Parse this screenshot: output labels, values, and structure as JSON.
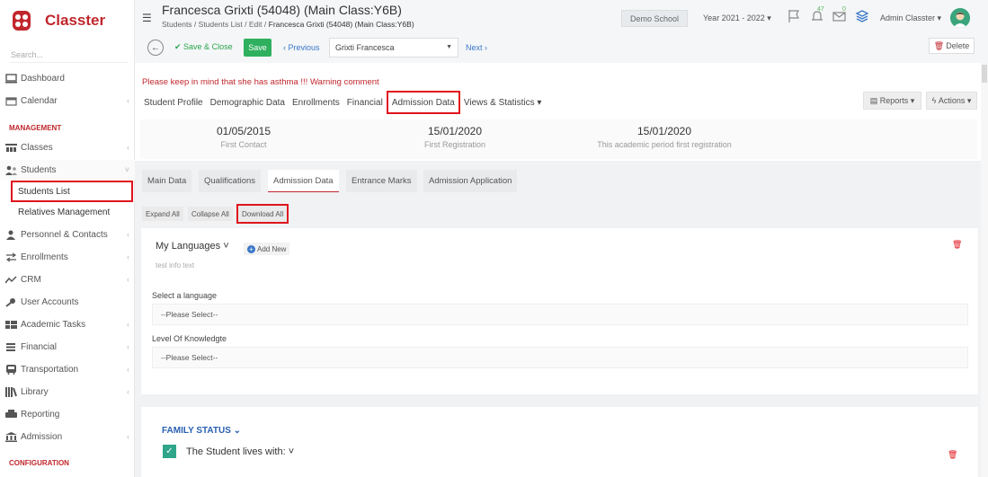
{
  "brand": {
    "name": "Classter",
    "color": "#c0272d"
  },
  "sidebar": {
    "search_placeholder": "Search...",
    "items_top": [
      {
        "label": "Dashboard",
        "icon": "monitor-icon"
      },
      {
        "label": "Calendar",
        "icon": "calendar-icon"
      }
    ],
    "section_management": "MANAGEMENT",
    "items_mgmt": [
      {
        "label": "Classes",
        "icon": "classes-icon"
      },
      {
        "label": "Students",
        "icon": "students-icon"
      }
    ],
    "students_sub": [
      "Students List",
      "Relatives Management"
    ],
    "items_rest": [
      {
        "label": "Personnel & Contacts",
        "icon": "personnel-icon"
      },
      {
        "label": "Enrollments",
        "icon": "enrollments-icon"
      },
      {
        "label": "CRM",
        "icon": "crm-icon"
      },
      {
        "label": "User Accounts",
        "icon": "key-icon"
      },
      {
        "label": "Academic Tasks",
        "icon": "tasks-icon"
      },
      {
        "label": "Financial",
        "icon": "financial-icon"
      },
      {
        "label": "Transportation",
        "icon": "bus-icon"
      },
      {
        "label": "Library",
        "icon": "library-icon"
      },
      {
        "label": "Reporting",
        "icon": "reporting-icon"
      },
      {
        "label": "Admission",
        "icon": "admission-icon"
      }
    ],
    "section_config": "CONFIGURATION"
  },
  "header": {
    "title": "Francesca Grixti (54048) (Main Class:Y6B)",
    "breadcrumbs": [
      "Students",
      "Students List",
      "Edit",
      "Francesca Grixti (54048) (Main Class:Y6B)"
    ],
    "school": "Demo School",
    "year": "Year 2021 - 2022",
    "notif_count": "47",
    "mail_count": "0",
    "user": "Admin Classter"
  },
  "toolbar": {
    "save_close": "Save & Close",
    "save": "Save",
    "previous": "Previous",
    "student_select": "Grixti Francesca",
    "next": "Next",
    "delete": "Delete"
  },
  "main": {
    "warning": "Please keep in mind that she has asthma !!! Warning comment",
    "tabs": [
      "Student Profile",
      "Demographic Data",
      "Enrollments",
      "Financial",
      "Admission Data",
      "Views & Statistics"
    ],
    "active_tab": "Admission Data",
    "reports": "Reports",
    "actions": "Actions",
    "dates": [
      {
        "value": "01/05/2015",
        "label": "First Contact"
      },
      {
        "value": "15/01/2020",
        "label": "First Registration"
      },
      {
        "value": "15/01/2020",
        "label": "This academic period first registration"
      }
    ],
    "subtabs": [
      "Main Data",
      "Qualifications",
      "Admission Data",
      "Entrance Marks",
      "Admission Application"
    ],
    "mini_buttons": [
      "Expand All",
      "Collapse All",
      "Download All"
    ],
    "languages_card": {
      "title": "My Languages",
      "add_new": "Add New",
      "info": "test info text",
      "field1_label": "Select a language",
      "field1_value": "--Please Select--",
      "field2_label": "Level Of Knowledgte",
      "field2_value": "--Please Select--"
    },
    "family_card": {
      "title": "FAMILY STATUS",
      "lives_with": "The Student lives with:"
    }
  }
}
